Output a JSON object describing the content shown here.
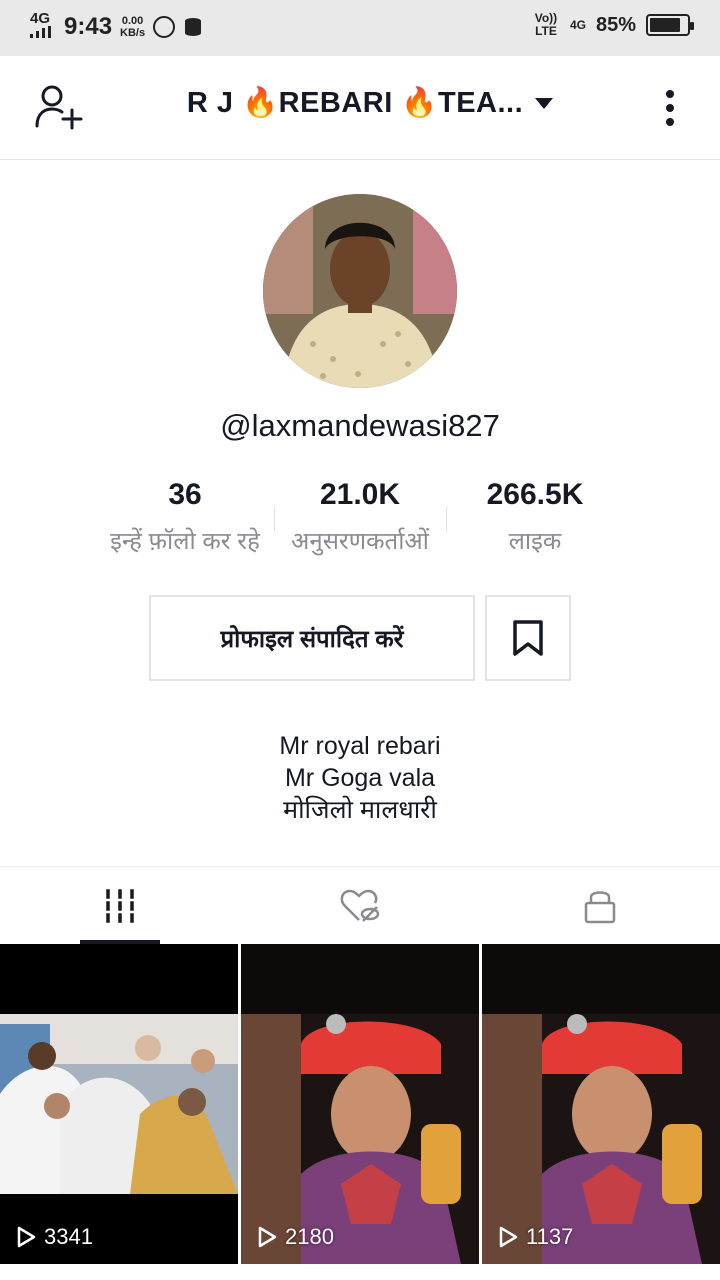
{
  "status_bar": {
    "network": "4G",
    "time": "9:43",
    "speed_value": "0.00",
    "speed_unit": "KB/s",
    "volte": "Vo)) LTE",
    "network_right": "4G",
    "battery": "85%",
    "battery_level": 0.85
  },
  "header": {
    "title": "R J 🔥REBARI 🔥TEA...",
    "add_user_icon": "add-user-icon",
    "more_icon": "more-vertical-icon"
  },
  "profile": {
    "username": "@laxmandewasi827",
    "stats": [
      {
        "value": "36",
        "label": "इन्हें फ़ॉलो कर रहे"
      },
      {
        "value": "21.0K",
        "label": "अनुसरणकर्ताओं"
      },
      {
        "value": "266.5K",
        "label": "लाइक"
      }
    ],
    "edit_button": "प्रोफाइल संपादित करें",
    "bio": [
      "Mr royal rebari",
      "Mr Goga vala",
      "मोजिलो मालधारी"
    ]
  },
  "tabs": [
    {
      "icon": "grid-icon",
      "active": true
    },
    {
      "icon": "liked-hidden-icon",
      "active": false
    },
    {
      "icon": "lock-icon",
      "active": false
    }
  ],
  "videos": [
    {
      "views": "3341"
    },
    {
      "views": "2180"
    },
    {
      "views": "1137"
    }
  ],
  "colors": {
    "text": "#161823",
    "muted": "#8a8b91",
    "border": "#e3e3e4",
    "status_bar": "#e9e9e9"
  }
}
